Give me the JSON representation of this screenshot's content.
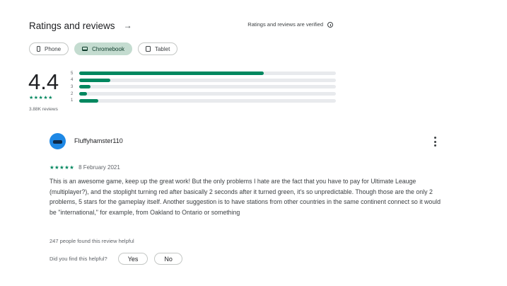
{
  "header": {
    "title": "Ratings and reviews",
    "arrow": "→",
    "verified_text": "Ratings and reviews are verified"
  },
  "chips": [
    {
      "label": "Phone",
      "icon": "phone-icon",
      "selected": false
    },
    {
      "label": "Chromebook",
      "icon": "laptop-icon",
      "selected": true
    },
    {
      "label": "Tablet",
      "icon": "tablet-icon",
      "selected": false
    }
  ],
  "summary": {
    "score": "4.4",
    "stars": "★★★★★",
    "stars_value": 4.4,
    "review_count": "3.88K reviews"
  },
  "distribution": [
    {
      "label": "5",
      "fraction": 0.72
    },
    {
      "label": "4",
      "fraction": 0.12
    },
    {
      "label": "3",
      "fraction": 0.045
    },
    {
      "label": "2",
      "fraction": 0.03
    },
    {
      "label": "1",
      "fraction": 0.075
    }
  ],
  "colors": {
    "accent": "#01875f",
    "chip_active_bg": "#c4dcd0",
    "track": "#e8eaed"
  },
  "review": {
    "author": "Fluffyhamster110",
    "stars": "★★★★★",
    "rating": 5,
    "date": "8 February 2021",
    "text": "This is an awesome game, keep up the great work! But the only problems I hate are the fact that you have to pay for Ultimate Leauge (multiplayer?), and the stoplight turning red after basically 2 seconds after it turned green, it's so unpredictable. Though those are the only 2 problems, 5 stars for the gameplay itself. Another suggestion is to have stations from other countries in the same continent connect so it would be \"international,\" for example, from Oakland to Ontario or something",
    "helpful_count": "247 people found this review helpful",
    "helpful_question": "Did you find this helpful?",
    "yes_label": "Yes",
    "no_label": "No"
  }
}
